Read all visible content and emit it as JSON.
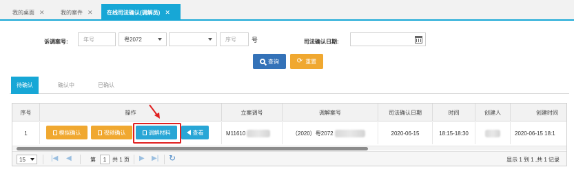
{
  "top_tabs": [
    {
      "label": "我的桌面",
      "close": "✕"
    },
    {
      "label": "我的案件",
      "close": "✕"
    },
    {
      "label": "在线司法确认(调解员)",
      "close": "✕"
    }
  ],
  "search": {
    "case_no_label": "诉调案号:",
    "year_placeholder": "年号",
    "court_code_value": "粤2072",
    "type_value": "",
    "seq_placeholder": "序号",
    "hao_suffix": "号",
    "date_label": "司法确认日期:",
    "date_value": "",
    "query_button": "查询",
    "reset_button": "重置"
  },
  "status_tabs": [
    "待确认",
    "确认中",
    "已确认"
  ],
  "table": {
    "headers": [
      "序号",
      "操作",
      "立案调号",
      "调解案号",
      "司法确认日期",
      "时间",
      "创建人",
      "创建时间"
    ],
    "rows": [
      {
        "index": "1",
        "actions": [
          "模拟确认",
          "视频确认",
          "调解材料",
          "查看"
        ],
        "filing_no": "M11610",
        "mediation_no": "（2020）粤2072",
        "confirm_date": "2020-06-15",
        "time": "18:15-18:30",
        "creator": "",
        "created_at": "2020-06-15 18:1"
      }
    ]
  },
  "pager": {
    "page_size": "15",
    "page_prefix": "第",
    "page_current": "1",
    "page_suffix": "共 1 页",
    "summary": "显示 1 到 1 ,共 1 记录"
  },
  "colors": {
    "accent": "#17a7d6",
    "primary_button": "#3472b8",
    "warning_button": "#f0a830",
    "highlight": "#e02020"
  }
}
